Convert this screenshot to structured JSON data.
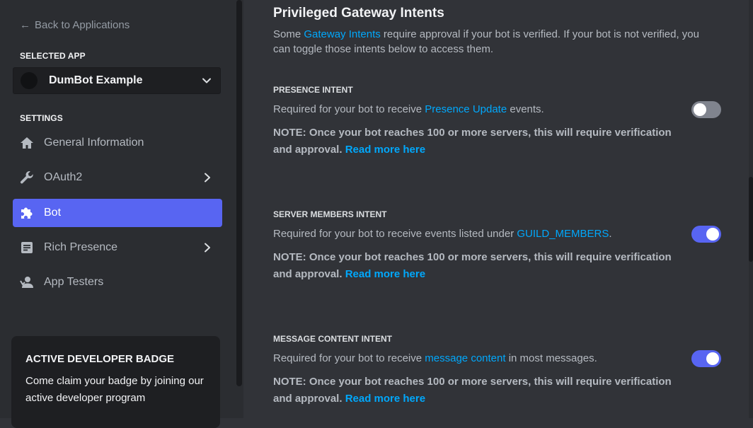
{
  "sidebar": {
    "back_label": "Back to Applications",
    "selected_app_label": "SELECTED APP",
    "app_name": "DumBot Example",
    "settings_label": "SETTINGS",
    "items": [
      {
        "label": "General Information",
        "icon": "home-icon"
      },
      {
        "label": "OAuth2",
        "icon": "wrench-icon",
        "has_submenu": true
      },
      {
        "label": "Bot",
        "icon": "puzzle-icon",
        "active": true
      },
      {
        "label": "Rich Presence",
        "icon": "document-icon",
        "has_submenu": true
      },
      {
        "label": "App Testers",
        "icon": "user-icon"
      }
    ],
    "badge": {
      "title": "ACTIVE DEVELOPER BADGE",
      "text": "Come claim your badge by joining our active developer program"
    }
  },
  "main": {
    "title": "Privileged Gateway Intents",
    "desc_prefix": "Some ",
    "desc_link": "Gateway Intents",
    "desc_suffix": " require approval if your bot is verified. If your bot is not verified, you can toggle those intents below to access them.",
    "note_text": "NOTE: Once your bot reaches 100 or more servers, this will require verification and approval.",
    "note_link": "Read more here",
    "intents": [
      {
        "label": "PRESENCE INTENT",
        "desc_prefix": "Required for your bot to receive ",
        "desc_link": "Presence Update",
        "desc_suffix": " events.",
        "enabled": false
      },
      {
        "label": "SERVER MEMBERS INTENT",
        "desc_prefix": "Required for your bot to receive events listed under ",
        "desc_link": "GUILD_MEMBERS",
        "desc_suffix": ".",
        "enabled": true
      },
      {
        "label": "MESSAGE CONTENT INTENT",
        "desc_prefix": "Required for your bot to receive ",
        "desc_link": "message content",
        "desc_suffix": " in most messages.",
        "enabled": true
      }
    ]
  },
  "colors": {
    "accent": "#5865f2",
    "link": "#00a8fc",
    "background": "#313338",
    "sidebar": "#2b2d31"
  }
}
